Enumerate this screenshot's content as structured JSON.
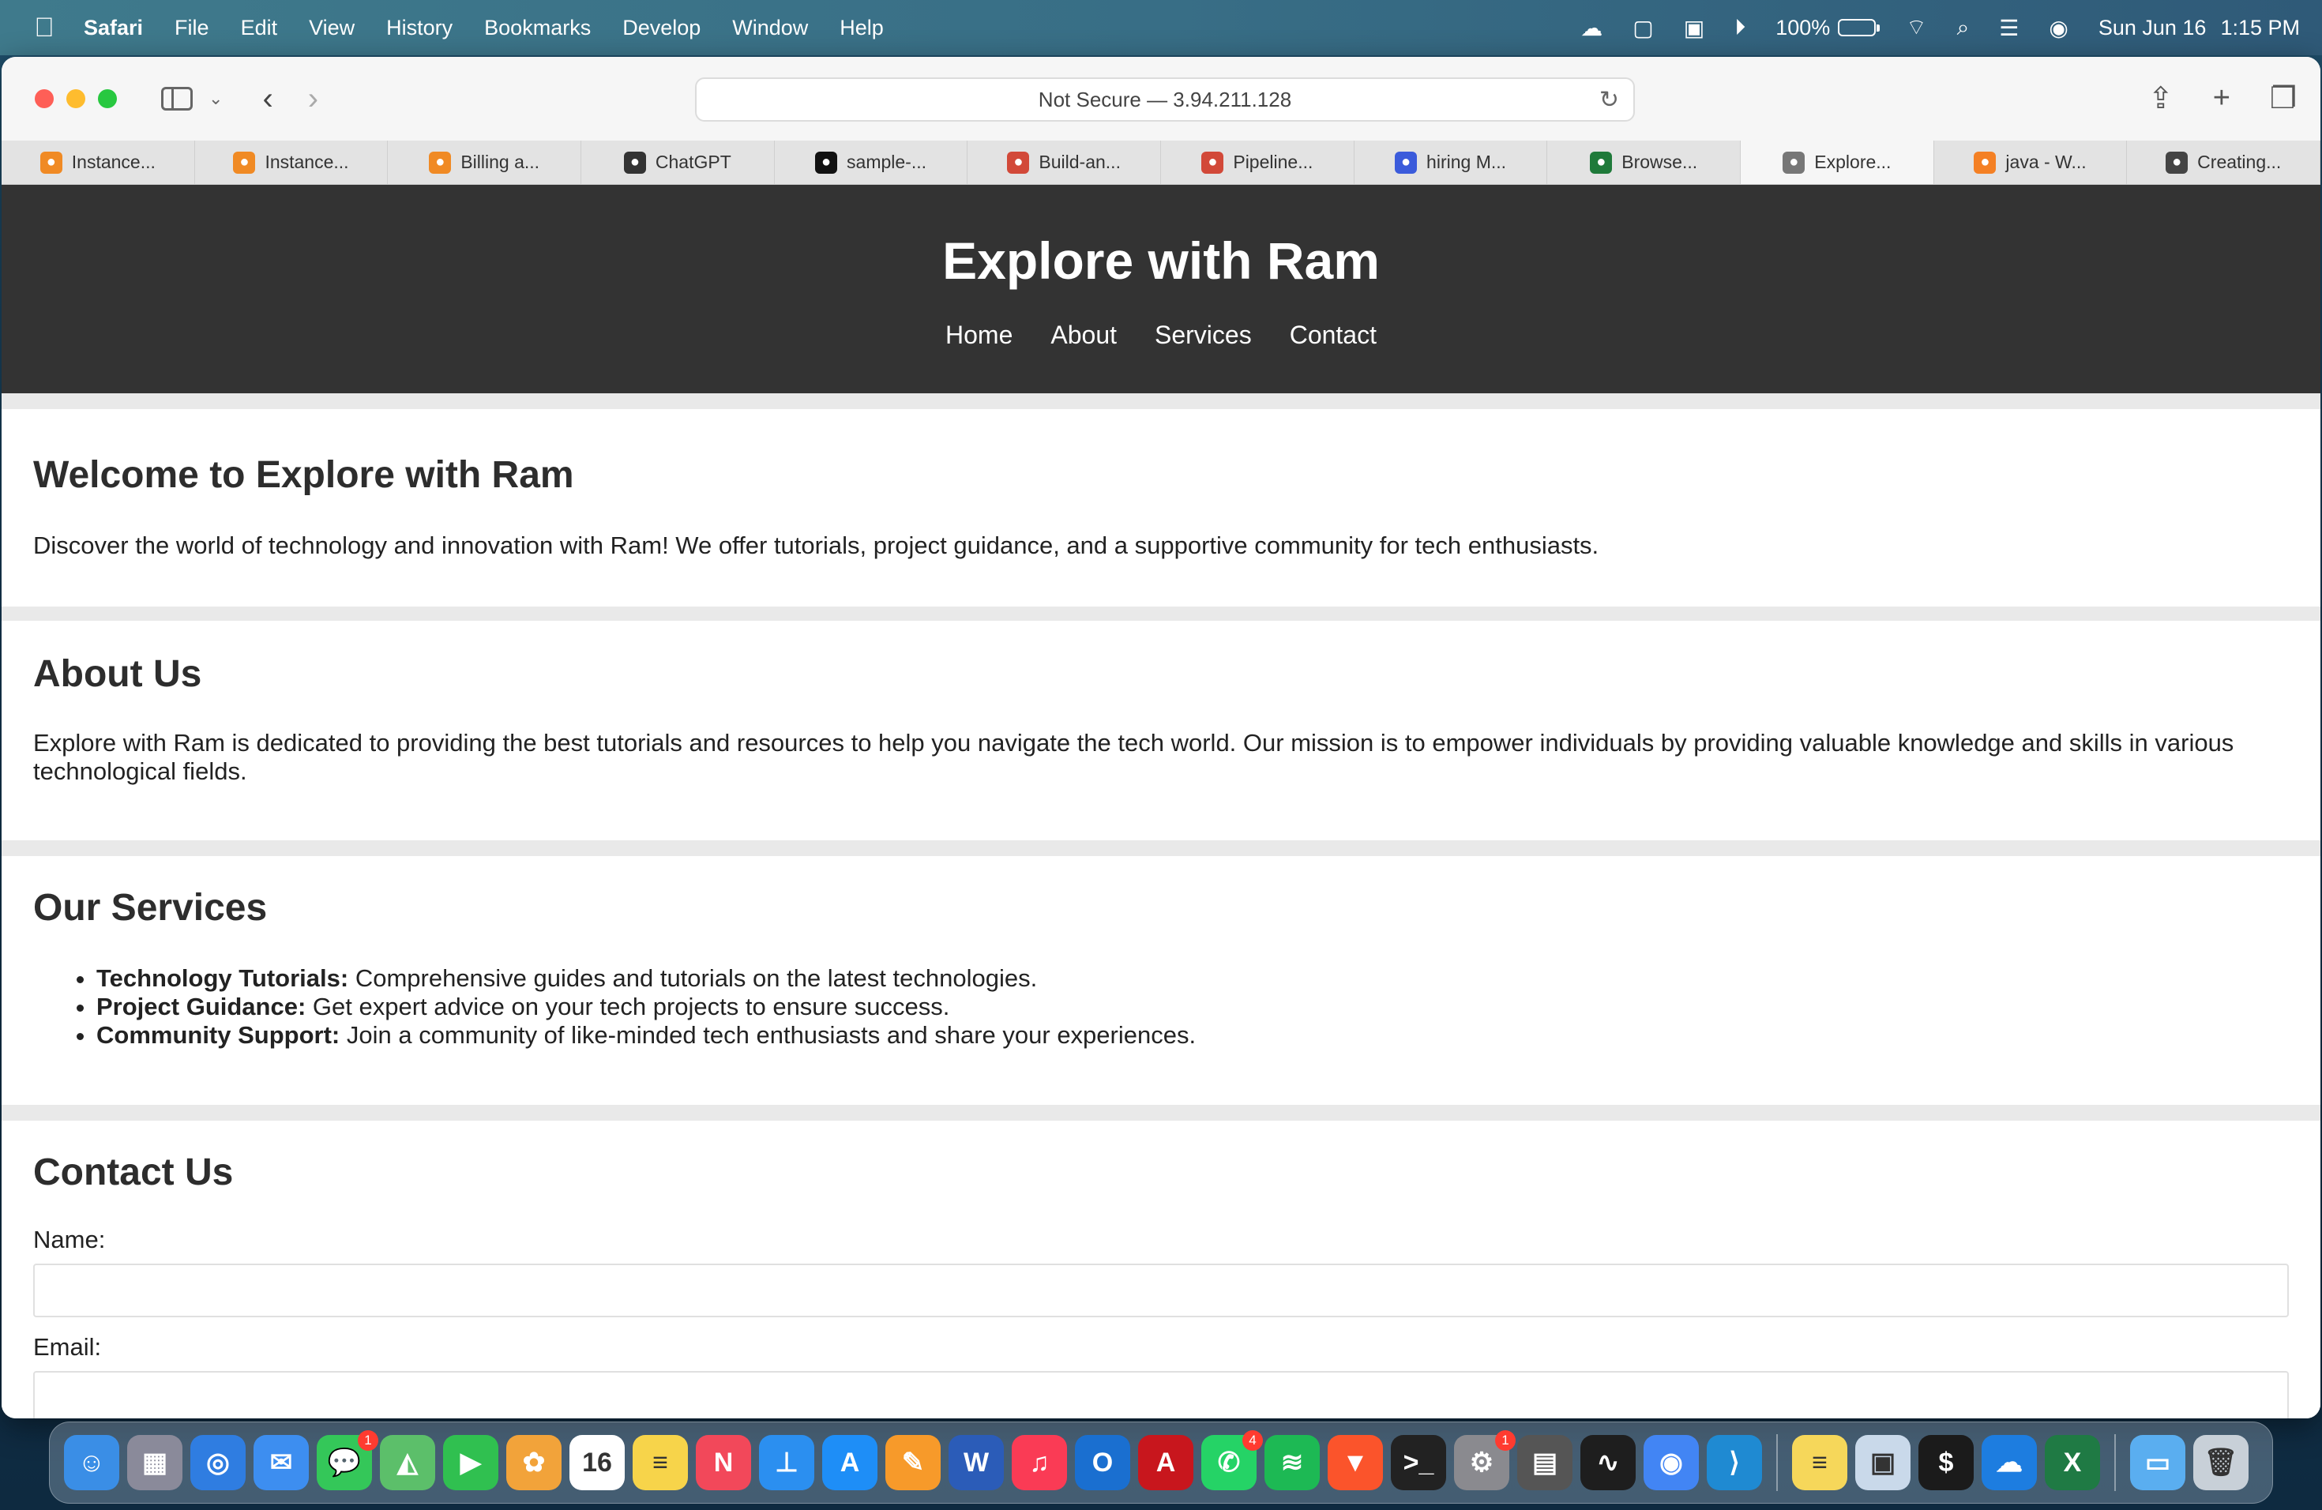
{
  "menubar": {
    "app_name": "Safari",
    "items": [
      "File",
      "Edit",
      "View",
      "History",
      "Bookmarks",
      "Develop",
      "Window",
      "Help"
    ],
    "battery": "100%",
    "date": "Sun Jun 16",
    "time": "1:15 PM"
  },
  "browser": {
    "address": "Not Secure — 3.94.211.128",
    "tabs": [
      {
        "label": "Instance...",
        "icon": "aws-cube-icon",
        "color": "#f08a24"
      },
      {
        "label": "Instance...",
        "icon": "aws-cube-icon",
        "color": "#f08a24"
      },
      {
        "label": "Billing a...",
        "icon": "aws-cube-icon",
        "color": "#f08a24"
      },
      {
        "label": "ChatGPT",
        "icon": "chatgpt-icon",
        "color": "#333333"
      },
      {
        "label": "sample-...",
        "icon": "github-icon",
        "color": "#111111"
      },
      {
        "label": "Build-an...",
        "icon": "jenkins-icon",
        "color": "#d24939"
      },
      {
        "label": "Pipeline...",
        "icon": "jenkins-icon",
        "color": "#d24939"
      },
      {
        "label": "hiring M...",
        "icon": "wave-icon",
        "color": "#3b5bdb"
      },
      {
        "label": "Browse...",
        "icon": "layers-icon",
        "color": "#1f7a3a"
      },
      {
        "label": "Explore...",
        "icon": "image-icon",
        "color": "#777777",
        "active": true
      },
      {
        "label": "java - W...",
        "icon": "stackoverflow-icon",
        "color": "#f48024"
      },
      {
        "label": "Creating...",
        "icon": "bike-icon",
        "color": "#444444"
      }
    ]
  },
  "site": {
    "title": "Explore with Ram",
    "nav": [
      "Home",
      "About",
      "Services",
      "Contact"
    ],
    "welcome": {
      "heading": "Welcome to Explore with Ram",
      "text": "Discover the world of technology and innovation with Ram! We offer tutorials, project guidance, and a supportive community for tech enthusiasts."
    },
    "about": {
      "heading": "About Us",
      "text": "Explore with Ram is dedicated to providing the best tutorials and resources to help you navigate the tech world. Our mission is to empower individuals by providing valuable knowledge and skills in various technological fields."
    },
    "services": {
      "heading": "Our Services",
      "items": [
        {
          "title": "Technology Tutorials:",
          "desc": " Comprehensive guides and tutorials on the latest technologies."
        },
        {
          "title": "Project Guidance:",
          "desc": " Get expert advice on your tech projects to ensure success."
        },
        {
          "title": "Community Support:",
          "desc": " Join a community of like-minded tech enthusiasts and share your experiences."
        }
      ]
    },
    "contact": {
      "heading": "Contact Us",
      "name_label": "Name:",
      "email_label": "Email:"
    }
  },
  "dock": {
    "apps": [
      {
        "name": "finder-icon",
        "color": "#3a8ee6",
        "glyph": "☺"
      },
      {
        "name": "launchpad-icon",
        "color": "#8a8a9a",
        "glyph": "▦"
      },
      {
        "name": "safari-icon",
        "color": "#2f7de1",
        "glyph": "◎"
      },
      {
        "name": "mail-icon",
        "color": "#3d8ef0",
        "glyph": "✉"
      },
      {
        "name": "messages-icon",
        "color": "#34c759",
        "glyph": "💬",
        "badge": "1"
      },
      {
        "name": "maps-icon",
        "color": "#5cbf6a",
        "glyph": "◭"
      },
      {
        "name": "facetime-icon",
        "color": "#30c050",
        "glyph": "▶"
      },
      {
        "name": "photos-icon",
        "color": "#f2a33a",
        "glyph": "✿"
      },
      {
        "name": "calendar-icon",
        "color": "#ffffff",
        "glyph": "16"
      },
      {
        "name": "notes-icon",
        "color": "#f7d44a",
        "glyph": "≡"
      },
      {
        "name": "news-icon",
        "color": "#f2485a",
        "glyph": "N"
      },
      {
        "name": "keynote-icon",
        "color": "#2b8ff0",
        "glyph": "⊥"
      },
      {
        "name": "app-store-icon",
        "color": "#1e8ef7",
        "glyph": "A"
      },
      {
        "name": "pages-icon",
        "color": "#f79a2a",
        "glyph": "✎"
      },
      {
        "name": "word-icon",
        "color": "#2b5cb8",
        "glyph": "W"
      },
      {
        "name": "music-icon",
        "color": "#fa3b55",
        "glyph": "♫"
      },
      {
        "name": "outlook-icon",
        "color": "#1a6fd0",
        "glyph": "O"
      },
      {
        "name": "acrobat-icon",
        "color": "#c8161d",
        "glyph": "A"
      },
      {
        "name": "whatsapp-icon",
        "color": "#25d366",
        "glyph": "✆",
        "badge": "4"
      },
      {
        "name": "spotify-icon",
        "color": "#1db954",
        "glyph": "≋"
      },
      {
        "name": "brave-icon",
        "color": "#fb542b",
        "glyph": "▼"
      },
      {
        "name": "terminal-icon",
        "color": "#222222",
        "glyph": ">_"
      },
      {
        "name": "system-settings-icon",
        "color": "#8a8a8f",
        "glyph": "⚙",
        "badge": "1"
      },
      {
        "name": "calculator-icon",
        "color": "#555555",
        "glyph": "▤"
      },
      {
        "name": "activity-monitor-icon",
        "color": "#1e1e1e",
        "glyph": "∿"
      },
      {
        "name": "chrome-icon",
        "color": "#4285f4",
        "glyph": "◉"
      },
      {
        "name": "vscode-icon",
        "color": "#1f8ad2",
        "glyph": "⟩"
      },
      {
        "name": "stickies-icon",
        "color": "#f6d75a",
        "glyph": "≡",
        "sep_before": true
      },
      {
        "name": "preview-icon",
        "color": "#c9d9ea",
        "glyph": "▣"
      },
      {
        "name": "iterm-icon",
        "color": "#1b1b1b",
        "glyph": "$"
      },
      {
        "name": "onedrive-icon",
        "color": "#1d7de0",
        "glyph": "☁"
      },
      {
        "name": "excel-icon",
        "color": "#1f7a44",
        "glyph": "X"
      },
      {
        "name": "downloads-folder-icon",
        "color": "#5aaef0",
        "glyph": "▭",
        "sep_before": true
      },
      {
        "name": "trash-icon",
        "color": "#c8d0d8",
        "glyph": "🗑"
      }
    ]
  }
}
